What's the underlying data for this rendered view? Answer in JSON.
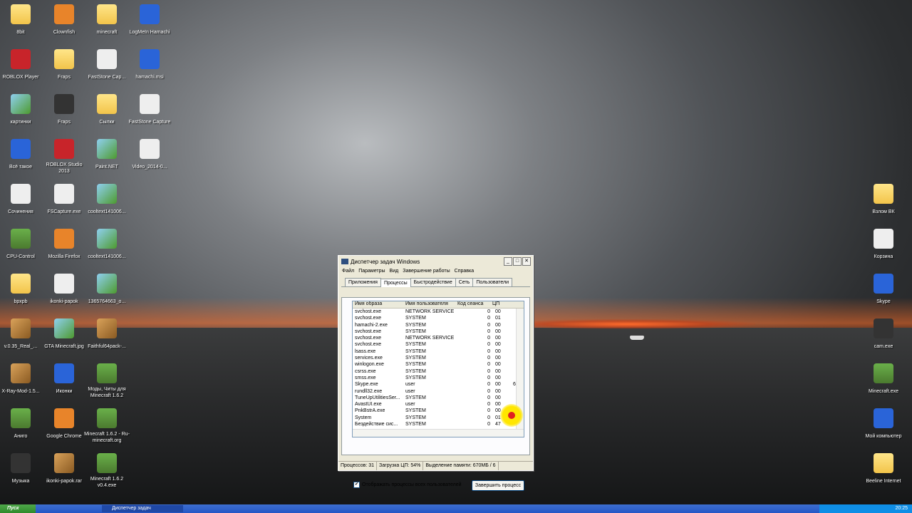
{
  "desktop": {
    "icons": [
      {
        "label": "8bit",
        "icon": "folder-icon"
      },
      {
        "label": "Clownfish",
        "icon": "clownfish-icon"
      },
      {
        "label": "minecraft",
        "icon": "folder-icon"
      },
      {
        "label": "LogMeIn Hamachi",
        "icon": "hamachi-icon"
      },
      {
        "label": "ROBLOX Player",
        "icon": "roblox-icon"
      },
      {
        "label": "Fraps",
        "icon": "folder-icon"
      },
      {
        "label": "FastStone Cap...",
        "icon": "faststone-icon"
      },
      {
        "label": "hamachi.msi",
        "icon": "installer-icon"
      },
      {
        "label": "картинки",
        "icon": "pictures-shortcut-icon"
      },
      {
        "label": "Fraps",
        "icon": "fraps-icon"
      },
      {
        "label": "Сылки",
        "icon": "folder-icon"
      },
      {
        "label": "FastStone Capture",
        "icon": "faststone-icon"
      },
      {
        "label": "Всё такое",
        "icon": "ie-icon"
      },
      {
        "label": "ROBLOX Studio 2013",
        "icon": "roblox-studio-icon"
      },
      {
        "label": "Paint.NET",
        "icon": "paintnet-icon"
      },
      {
        "label": "Video_2014-0...",
        "icon": "video-file-icon"
      },
      {
        "label": "Сочинения",
        "icon": "documents-icon"
      },
      {
        "label": "FSCapture.exe",
        "icon": "faststone-icon"
      },
      {
        "label": "cooltext141006...",
        "icon": "image-file-icon"
      },
      {
        "label": "CPU-Control",
        "icon": "cpu-icon"
      },
      {
        "label": "Mozilla Firefox",
        "icon": "firefox-icon"
      },
      {
        "label": "cooltext141006...",
        "icon": "image-file-icon"
      },
      {
        "label": "bpxpb",
        "icon": "folder-icon"
      },
      {
        "label": "ikonki-papok",
        "icon": "keyboard-icon"
      },
      {
        "label": "1365764663_o...",
        "icon": "image-file-icon"
      },
      {
        "label": "v.0.35_Real_...",
        "icon": "archive-icon"
      },
      {
        "label": "GTA Minecraft.jpg",
        "icon": "image-file-icon"
      },
      {
        "label": "Faithful64pack-...",
        "icon": "archive-icon"
      },
      {
        "label": "X-Ray-Mod-1.5...",
        "icon": "archive-icon"
      },
      {
        "label": "Иконки",
        "icon": "icons-folder-icon"
      },
      {
        "label": "Моды, Читы для Minecraft 1.6.2",
        "icon": "minecraft-icon"
      },
      {
        "label": "Аниго",
        "icon": "anigo-icon"
      },
      {
        "label": "Google Chrome",
        "icon": "chrome-icon"
      },
      {
        "label": "Minecraft 1.6.2 - Ru-minecraft.org",
        "icon": "minecraft-icon"
      },
      {
        "label": "Музыка",
        "icon": "music-icon"
      },
      {
        "label": "ikonki-papok.rar",
        "icon": "archive-icon"
      },
      {
        "label": "Minecraft 1.6.2 v0.4.exe",
        "icon": "minecraft-icon"
      },
      {
        "label": "Взлом ВК",
        "icon": "folder-icon"
      },
      {
        "label": "Корзина",
        "icon": "recycle-bin-icon"
      },
      {
        "label": "Skype",
        "icon": "skype-icon"
      },
      {
        "label": "cam.exe",
        "icon": "cam-icon"
      },
      {
        "label": "Minecraft.exe",
        "icon": "minecraft-icon"
      },
      {
        "label": "Мой компьютер",
        "icon": "my-computer-icon"
      },
      {
        "label": "Beeline Internet",
        "icon": "beeline-icon"
      }
    ]
  },
  "task_manager": {
    "title": "Диспетчер задач Windows",
    "window_buttons": {
      "minimize": "_",
      "maximize": "□",
      "close": "✕"
    },
    "menu": [
      "Файл",
      "Параметры",
      "Вид",
      "Завершение работы",
      "Справка"
    ],
    "tabs": [
      "Приложения",
      "Процессы",
      "Быстродействие",
      "Сеть",
      "Пользователи"
    ],
    "active_tab": "Процессы",
    "columns": [
      "Имя образа",
      "Имя пользователя",
      "Код сеанса",
      "ЦП",
      ""
    ],
    "rows": [
      [
        "svchost.exe",
        "NETWORK SERVICE",
        "0",
        "00",
        ""
      ],
      [
        "svchost.exe",
        "SYSTEM",
        "0",
        "01",
        ""
      ],
      [
        "hamachi-2.exe",
        "SYSTEM",
        "0",
        "00",
        ""
      ],
      [
        "svchost.exe",
        "SYSTEM",
        "0",
        "00",
        ""
      ],
      [
        "svchost.exe",
        "NETWORK SERVICE",
        "0",
        "00",
        ""
      ],
      [
        "svchost.exe",
        "SYSTEM",
        "0",
        "00",
        ""
      ],
      [
        "lsass.exe",
        "SYSTEM",
        "0",
        "00",
        ""
      ],
      [
        "services.exe",
        "SYSTEM",
        "0",
        "00",
        ""
      ],
      [
        "winlogon.exe",
        "SYSTEM",
        "0",
        "00",
        ""
      ],
      [
        "csrss.exe",
        "SYSTEM",
        "0",
        "00",
        ""
      ],
      [
        "smss.exe",
        "SYSTEM",
        "0",
        "00",
        ""
      ],
      [
        "Skype.exe",
        "user",
        "0",
        "00",
        "6"
      ],
      [
        "rundll32.exe",
        "user",
        "0",
        "00",
        ""
      ],
      [
        "TuneUpUtilitiesSer...",
        "SYSTEM",
        "0",
        "00",
        ""
      ],
      [
        "AvastUI.exe",
        "user",
        "0",
        "00",
        ""
      ],
      [
        "PnkBstrA.exe",
        "SYSTEM",
        "0",
        "00",
        ""
      ],
      [
        "System",
        "SYSTEM",
        "0",
        "01",
        ""
      ],
      [
        "Бездействие сис...",
        "SYSTEM",
        "0",
        "47",
        ""
      ]
    ],
    "show_all_users_label": "Отображать процессы всех пользователей",
    "show_all_users_checked": true,
    "end_process_label": "Завершить процесс",
    "status": {
      "processes": "Процессов: 31",
      "cpu": "Загрузка ЦП: 54%",
      "memory": "Выделение памяти: 670МБ / 6"
    }
  },
  "taskbar": {
    "start_label": "Пуск",
    "active_window": "Диспетчер задач",
    "clock": "20:25"
  }
}
